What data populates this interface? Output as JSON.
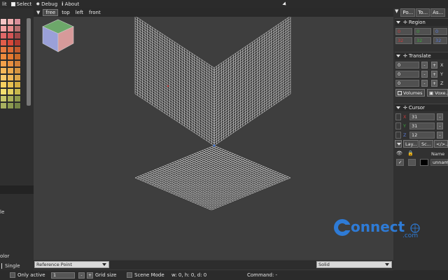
{
  "menu": {
    "items": [
      {
        "label": "lit",
        "icon": "",
        "id": "file"
      },
      {
        "label": "Select",
        "icon": "checkbox",
        "id": "select"
      },
      {
        "label": "Debug",
        "icon": "bug",
        "id": "debug"
      },
      {
        "label": "About",
        "icon": "info",
        "id": "about"
      }
    ]
  },
  "viewport": {
    "tabs": [
      "free",
      "top",
      "left",
      "front"
    ],
    "active_tab": "free"
  },
  "palette": {
    "colors": [
      "#f4c6c6",
      "#f0b0b0",
      "#d98f9a",
      "#f2a2a2",
      "#e88b8b",
      "#b87070",
      "#e06868",
      "#d45555",
      "#a04848",
      "#e35d4a",
      "#d8493a",
      "#b23a30",
      "#e87a40",
      "#dc6a34",
      "#c15b2e",
      "#f08a3c",
      "#e67a30",
      "#c96a28",
      "#f4a14a",
      "#e89040",
      "#d07f38",
      "#f6b85a",
      "#eca84c",
      "#d69440",
      "#f8c86a",
      "#f0b858",
      "#dca548",
      "#f6d060",
      "#e8c050",
      "#d4ad42",
      "#f4e070",
      "#e4d060",
      "#c8b84c",
      "#c8c86a",
      "#aab058",
      "#8e9a4c",
      "#a8b060",
      "#8c9a50",
      "#748446"
    ]
  },
  "left_panel": {
    "label_de": "le",
    "label_olor": "olor",
    "label_single": "Single"
  },
  "viewport_bottom": {
    "reference_dropdown": "Reference Point",
    "render_dropdown": "Solid"
  },
  "status": {
    "only_active": "Only active",
    "grid_value": "1",
    "minus": "-",
    "plus": "+",
    "grid_size": "Grid size",
    "scene_mode": "Scene Mode",
    "dims": "w: 0, h: 0, d: 0",
    "command": "Command: -"
  },
  "right_panel": {
    "tabs": [
      "Po...",
      "To...",
      "As..."
    ],
    "region": {
      "title": "Region",
      "row1": [
        "0",
        "0",
        "0"
      ],
      "row2": [
        "32",
        "32",
        "32"
      ]
    },
    "translate": {
      "title": "Translate",
      "rows": [
        {
          "value": "0",
          "axis": "X"
        },
        {
          "value": "0",
          "axis": "Y"
        },
        {
          "value": "0",
          "axis": "Z"
        }
      ],
      "minus": "-",
      "plus": "+"
    },
    "modes": [
      "Volumes",
      "Voxe..."
    ],
    "cursor": {
      "title": "Cursor",
      "rows": [
        {
          "axis": "X",
          "value": "31"
        },
        {
          "axis": "Y",
          "value": "31"
        },
        {
          "axis": "Z",
          "value": "12"
        }
      ],
      "minus": "-"
    },
    "layer_tabs": [
      "Lay...",
      "Sc...",
      "</>..."
    ],
    "layers": {
      "header_name": "Name",
      "row_name": "unname..."
    }
  },
  "watermark": {
    "text": "onnect",
    "sub": ".com"
  },
  "colors": {
    "accent_blue": "#2e7bd6",
    "region_red": "#c83a3a",
    "region_green": "#3aa63a",
    "region_blue": "#3a5bc8"
  }
}
